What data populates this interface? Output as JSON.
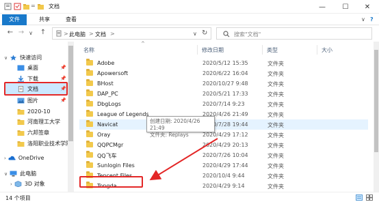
{
  "window": {
    "title": "文档",
    "controls": {
      "minimize": "—",
      "maximize": "☐",
      "close": "✕"
    }
  },
  "ribbon": {
    "tabs": [
      "文件",
      "共享",
      "查看"
    ],
    "expand_icon": "∨",
    "help_icon": "?"
  },
  "address": {
    "back": "←",
    "forward": "→",
    "recent": "∨",
    "up": "↑",
    "crumbs": [
      "此电脑",
      "文档"
    ],
    "separators": [
      ">",
      ">",
      ">"
    ],
    "refresh": "↻",
    "search_placeholder": "搜索\"文档\""
  },
  "nav": {
    "quick_access": "快速访问",
    "items": [
      {
        "label": "桌面",
        "pinned": true
      },
      {
        "label": "下载",
        "pinned": true
      },
      {
        "label": "文档",
        "pinned": true,
        "selected": true
      },
      {
        "label": "图片",
        "pinned": true
      },
      {
        "label": "2020-10"
      },
      {
        "label": "河南理工大学"
      },
      {
        "label": "六邦签章"
      },
      {
        "label": "洛阳职业技术学院"
      }
    ],
    "onedrive": "OneDrive",
    "this_pc": "此电脑",
    "objects_3d": "3D 对象",
    "pin_glyph": "📌"
  },
  "list": {
    "columns": {
      "name": "名称",
      "date": "修改日期",
      "type": "类型",
      "size": "大小"
    },
    "files": [
      {
        "name": "Adobe",
        "date": "2020/5/12 15:35",
        "type": "文件夹"
      },
      {
        "name": "Apowersoft",
        "date": "2020/6/22 16:04",
        "type": "文件夹"
      },
      {
        "name": "BHost",
        "date": "2020/10/27 9:48",
        "type": "文件夹"
      },
      {
        "name": "DAP_PC",
        "date": "2020/5/21 17:33",
        "type": "文件夹"
      },
      {
        "name": "DbgLogs",
        "date": "2020/7/14 9:23",
        "type": "文件夹"
      },
      {
        "name": "League of Legends",
        "date": "2020/4/26 21:49",
        "type": "文件夹"
      },
      {
        "name": "Navicat",
        "date": "2020/7/28 19:44",
        "type": "文件夹"
      },
      {
        "name": "Oray",
        "date": "2020/4/29 17:12",
        "type": "文件夹"
      },
      {
        "name": "QQPCMgr",
        "date": "2020/4/29 20:13",
        "type": "文件夹"
      },
      {
        "name": "QQ飞车",
        "date": "2020/7/26 10:04",
        "type": "文件夹"
      },
      {
        "name": "Sunlogin Files",
        "date": "2020/4/29 17:44",
        "type": "文件夹"
      },
      {
        "name": "Tencent Files",
        "date": "2020/10/4 9:44",
        "type": "文件夹"
      },
      {
        "name": "Tongda",
        "date": "2020/4/29 9:14",
        "type": "文件夹"
      }
    ]
  },
  "tooltip": {
    "line1": "创建日期: 2020/4/26 21:49",
    "line2": "文件夹: Replays"
  },
  "status": {
    "count": "14 个项目"
  },
  "colors": {
    "accent": "#1979ca",
    "annotation": "#e32626",
    "folder": "#f2c94c"
  }
}
